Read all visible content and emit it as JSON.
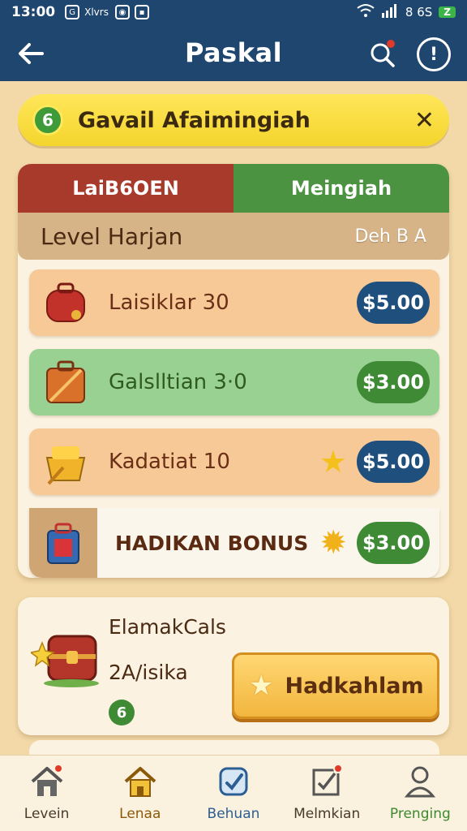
{
  "status_bar": {
    "time": "13:00",
    "small_text": "Xlvrs",
    "network": "8 6S",
    "battery": "Z"
  },
  "header": {
    "title": "Paskal"
  },
  "banner": {
    "coin_text": "6",
    "text": "Gavail Afaimingiah"
  },
  "tabs": {
    "left": "LaiB6OEN",
    "right": "Meingiah"
  },
  "section": {
    "heading": "Level Harjan",
    "subheading": "Deh B A"
  },
  "rows": [
    {
      "label": "Laisiklar 30",
      "price": "$5.00"
    },
    {
      "label": "Galslltian 3·0",
      "price": "$3.00"
    },
    {
      "label": "Kadatiat 10",
      "price": "$5.00"
    },
    {
      "label": "HADIKAN BONUS",
      "price": "$3.00"
    }
  ],
  "promo": {
    "line1": "ElamakCals",
    "line2": "2A/isika",
    "badge": "6",
    "cta": "Hadkahlam"
  },
  "nav": [
    {
      "label": "Levein"
    },
    {
      "label": "Lenaa"
    },
    {
      "label": "Behuan"
    },
    {
      "label": "Melmkian"
    },
    {
      "label": "Prenging"
    }
  ],
  "colors": {
    "header_bg": "#1e466e",
    "banner": "#f4d52c",
    "tab_red": "#a83a2c",
    "tab_green": "#4c9341",
    "price_blue": "#1f4f7c",
    "price_green": "#3f8a35"
  }
}
